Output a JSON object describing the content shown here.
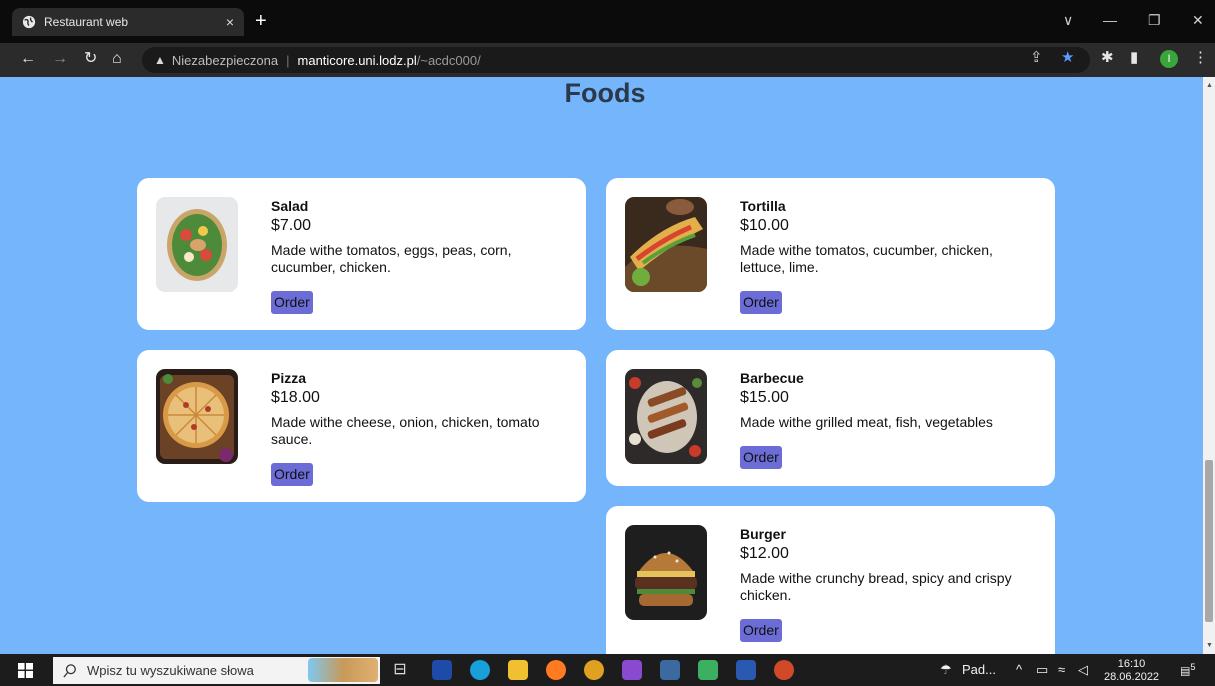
{
  "browser": {
    "tab_title": "Restaurant web",
    "tab_close": "×",
    "new_tab": "+",
    "security_label": "Niezabezpieczona",
    "url_host": "manticore.uni.lodz.pl",
    "url_path": "/~acdc000/",
    "profile_initial": "I",
    "window_controls": [
      "∨",
      "—",
      "❐",
      "✕"
    ]
  },
  "page": {
    "title": "Foods"
  },
  "foods": [
    {
      "name": "Salad",
      "price": "$7.00",
      "description": "Made withe tomatos, eggs, peas, corn, cucumber, chicken.",
      "order_label": "Order",
      "image": "salad-bowl"
    },
    {
      "name": "Tortilla",
      "price": "$10.00",
      "description": "Made withe tomatos, cucumber, chicken, lettuce, lime.",
      "order_label": "Order",
      "image": "tacos"
    },
    {
      "name": "Pizza",
      "price": "$18.00",
      "description": "Made withe cheese, onion, chicken, tomato sauce.",
      "order_label": "Order",
      "image": "pizza"
    },
    {
      "name": "Barbecue",
      "price": "$15.00",
      "description": "Made withe grilled meat, fish, vegetables",
      "order_label": "Order",
      "image": "barbecue-platter"
    },
    {
      "name": "Burger",
      "price": "$12.00",
      "description": "Made withe crunchy bread, spicy and crispy chicken.",
      "order_label": "Order",
      "image": "burger"
    }
  ],
  "taskbar": {
    "search_placeholder": "Wpisz tu wyszukiwane słowa",
    "weather_label": "Pad...",
    "time": "16:10",
    "date": "28.06.2022",
    "notification_count": "5"
  },
  "colors": {
    "page_background": "#75b5fc",
    "order_button": "#6c6cd6",
    "card_background": "#ffffff"
  }
}
